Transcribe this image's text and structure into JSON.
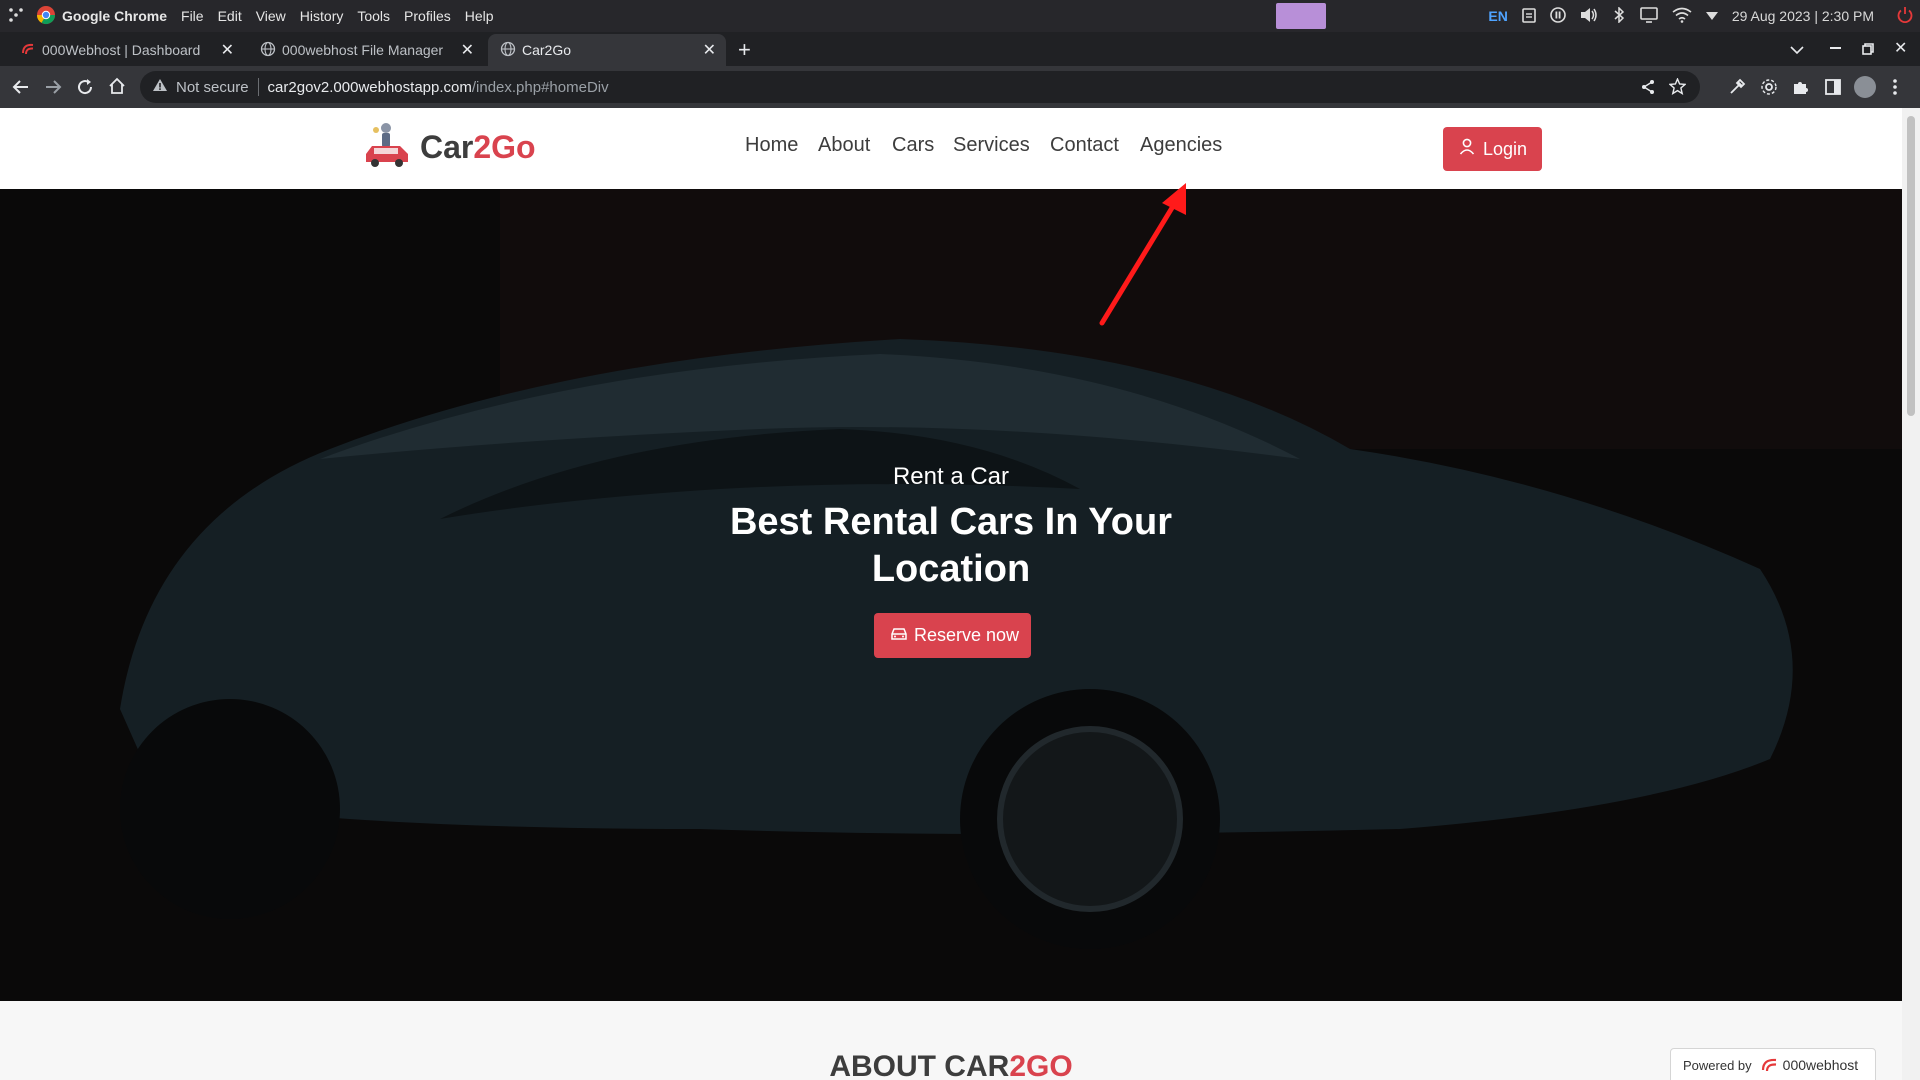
{
  "os_bar": {
    "app_name": "Google Chrome",
    "menu": [
      "File",
      "Edit",
      "View",
      "History",
      "Tools",
      "Profiles",
      "Help"
    ],
    "language": "EN",
    "datetime": "29 Aug 2023 | 2:30 PM"
  },
  "browser": {
    "tabs": [
      {
        "title": "000Webhost | Dashboard",
        "active": false
      },
      {
        "title": "000webhost File Manager",
        "active": false
      },
      {
        "title": "Car2Go",
        "active": true
      }
    ],
    "security_label": "Not secure",
    "url_host": "car2gov2.000webhostapp.com",
    "url_path": "/index.php#homeDiv"
  },
  "site": {
    "brand_part1": "Car",
    "brand_part2": "2Go",
    "nav": [
      "Home",
      "About",
      "Cars",
      "Services",
      "Contact",
      "Agencies"
    ],
    "login_label": "Login",
    "hero": {
      "subtitle": "Rent a Car",
      "title_line1": "Best Rental Cars In Your",
      "title_line2": "Location",
      "cta_label": "Reserve now"
    },
    "about_part1": "ABOUT CAR",
    "about_part2": "2GO"
  },
  "badge": {
    "prefix": "Powered by",
    "brand": "000webhost"
  },
  "colors": {
    "accent": "#d9434e",
    "annotation": "#ff1a1a"
  },
  "icons": [
    "chrome-logo",
    "power-icon",
    "user-icon",
    "car-icon",
    "share-icon",
    "star-icon",
    "extension-icon"
  ]
}
